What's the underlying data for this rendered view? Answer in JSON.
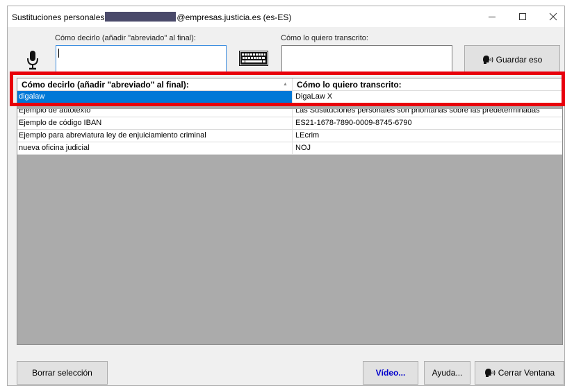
{
  "window": {
    "title_prefix": "Sustituciones personales",
    "title_suffix": "@empresas.justicia.es (es-ES)",
    "minimize_icon": "minimize-icon",
    "maximize_icon": "maximize-icon",
    "close_icon": "close-icon"
  },
  "form": {
    "say_label": "Cómo decirlo (añadir \"abreviado\" al final):",
    "say_value": "",
    "transcribe_label": "Cómo lo quiero transcrito:",
    "transcribe_value": "",
    "save_button": "Guardar eso"
  },
  "grid": {
    "columns": [
      "Cómo decirlo (añadir \"abreviado\" al final):",
      "Cómo lo quiero transcrito:"
    ],
    "rows": [
      {
        "say": "digalaw",
        "transcribed": "DigaLaw X",
        "selected": true
      },
      {
        "say": "Ejemplo de autotexto",
        "transcribed": "Las Sustituciones personales son prioritarias sobre las predeterminadas"
      },
      {
        "say": "Ejemplo de código IBAN",
        "transcribed": "ES21-1678-7890-0009-8745-6790"
      },
      {
        "say": "Ejemplo para abreviatura ley de enjuiciamiento criminal",
        "transcribed": "LEcrim"
      },
      {
        "say": "nueva oficina judicial",
        "transcribed": "NOJ"
      }
    ]
  },
  "footer": {
    "delete_button": "Borrar selección",
    "video_button": "Vídeo...",
    "help_button": "Ayuda...",
    "close_button": "Cerrar Ventana"
  },
  "colors": {
    "selection": "#0078d7",
    "highlight": "#e8000b",
    "grid_background": "#ababab"
  }
}
